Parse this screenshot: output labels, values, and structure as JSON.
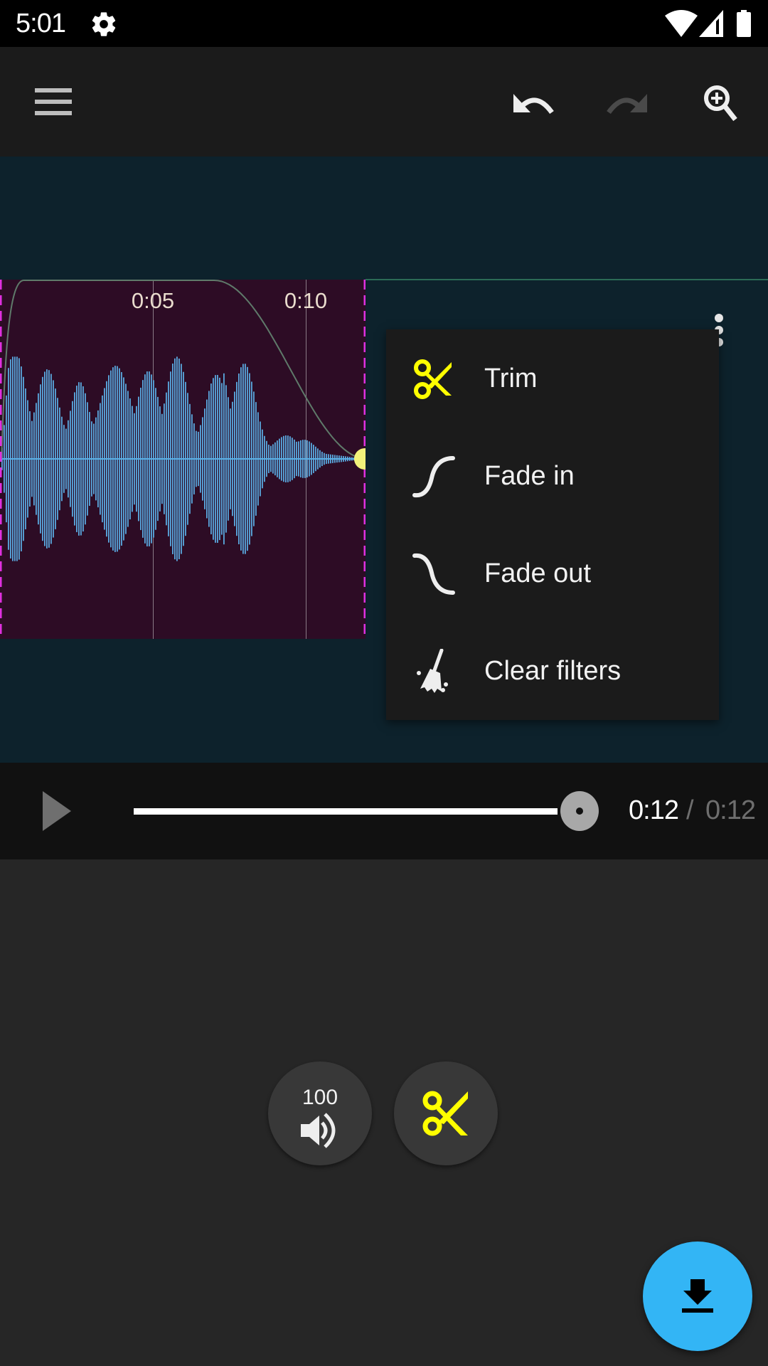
{
  "status_bar": {
    "time": "5:01",
    "icons": [
      "settings-gear-icon",
      "wifi-icon",
      "cell-signal-icon",
      "battery-icon"
    ]
  },
  "toolbar": {
    "menu_icon": "hamburger-menu-icon",
    "undo": {
      "icon": "undo-icon",
      "enabled": true
    },
    "redo": {
      "icon": "redo-icon",
      "enabled": false
    },
    "zoom": {
      "icon": "zoom-in-icon"
    }
  },
  "waveform": {
    "clip_color": "#2d0c25",
    "wave_color": "#5aa9e0",
    "background": "#0d222c",
    "time_ticks": [
      {
        "label": "0:05",
        "seconds": 5
      },
      {
        "label": "0:10",
        "seconds": 10
      }
    ],
    "clip_duration_seconds": 12,
    "fade_in_end_seconds": 0.4,
    "fade_out_start_seconds": 7,
    "playhead_seconds": 12,
    "marker_color": "#e030e0",
    "handle_color": "#f2f27a"
  },
  "context_menu": {
    "items": [
      {
        "label": "Trim",
        "icon": "scissors-icon",
        "color": "#ffff00"
      },
      {
        "label": "Fade in",
        "icon": "fade-in-curve-icon",
        "color": "#eeeeee"
      },
      {
        "label": "Fade out",
        "icon": "fade-out-curve-icon",
        "color": "#eeeeee"
      },
      {
        "label": "Clear filters",
        "icon": "broom-icon",
        "color": "#eeeeee"
      }
    ]
  },
  "player": {
    "play_icon": "play-icon",
    "current_time": "0:12",
    "separator": "/",
    "total_time": "0:12",
    "progress": 1.0
  },
  "bottom_controls": {
    "volume": {
      "value": "100",
      "icon": "volume-icon"
    },
    "trim": {
      "icon": "scissors-icon",
      "color": "#ffff00"
    },
    "fab": {
      "icon": "download-icon",
      "color": "#33b5f5"
    }
  }
}
